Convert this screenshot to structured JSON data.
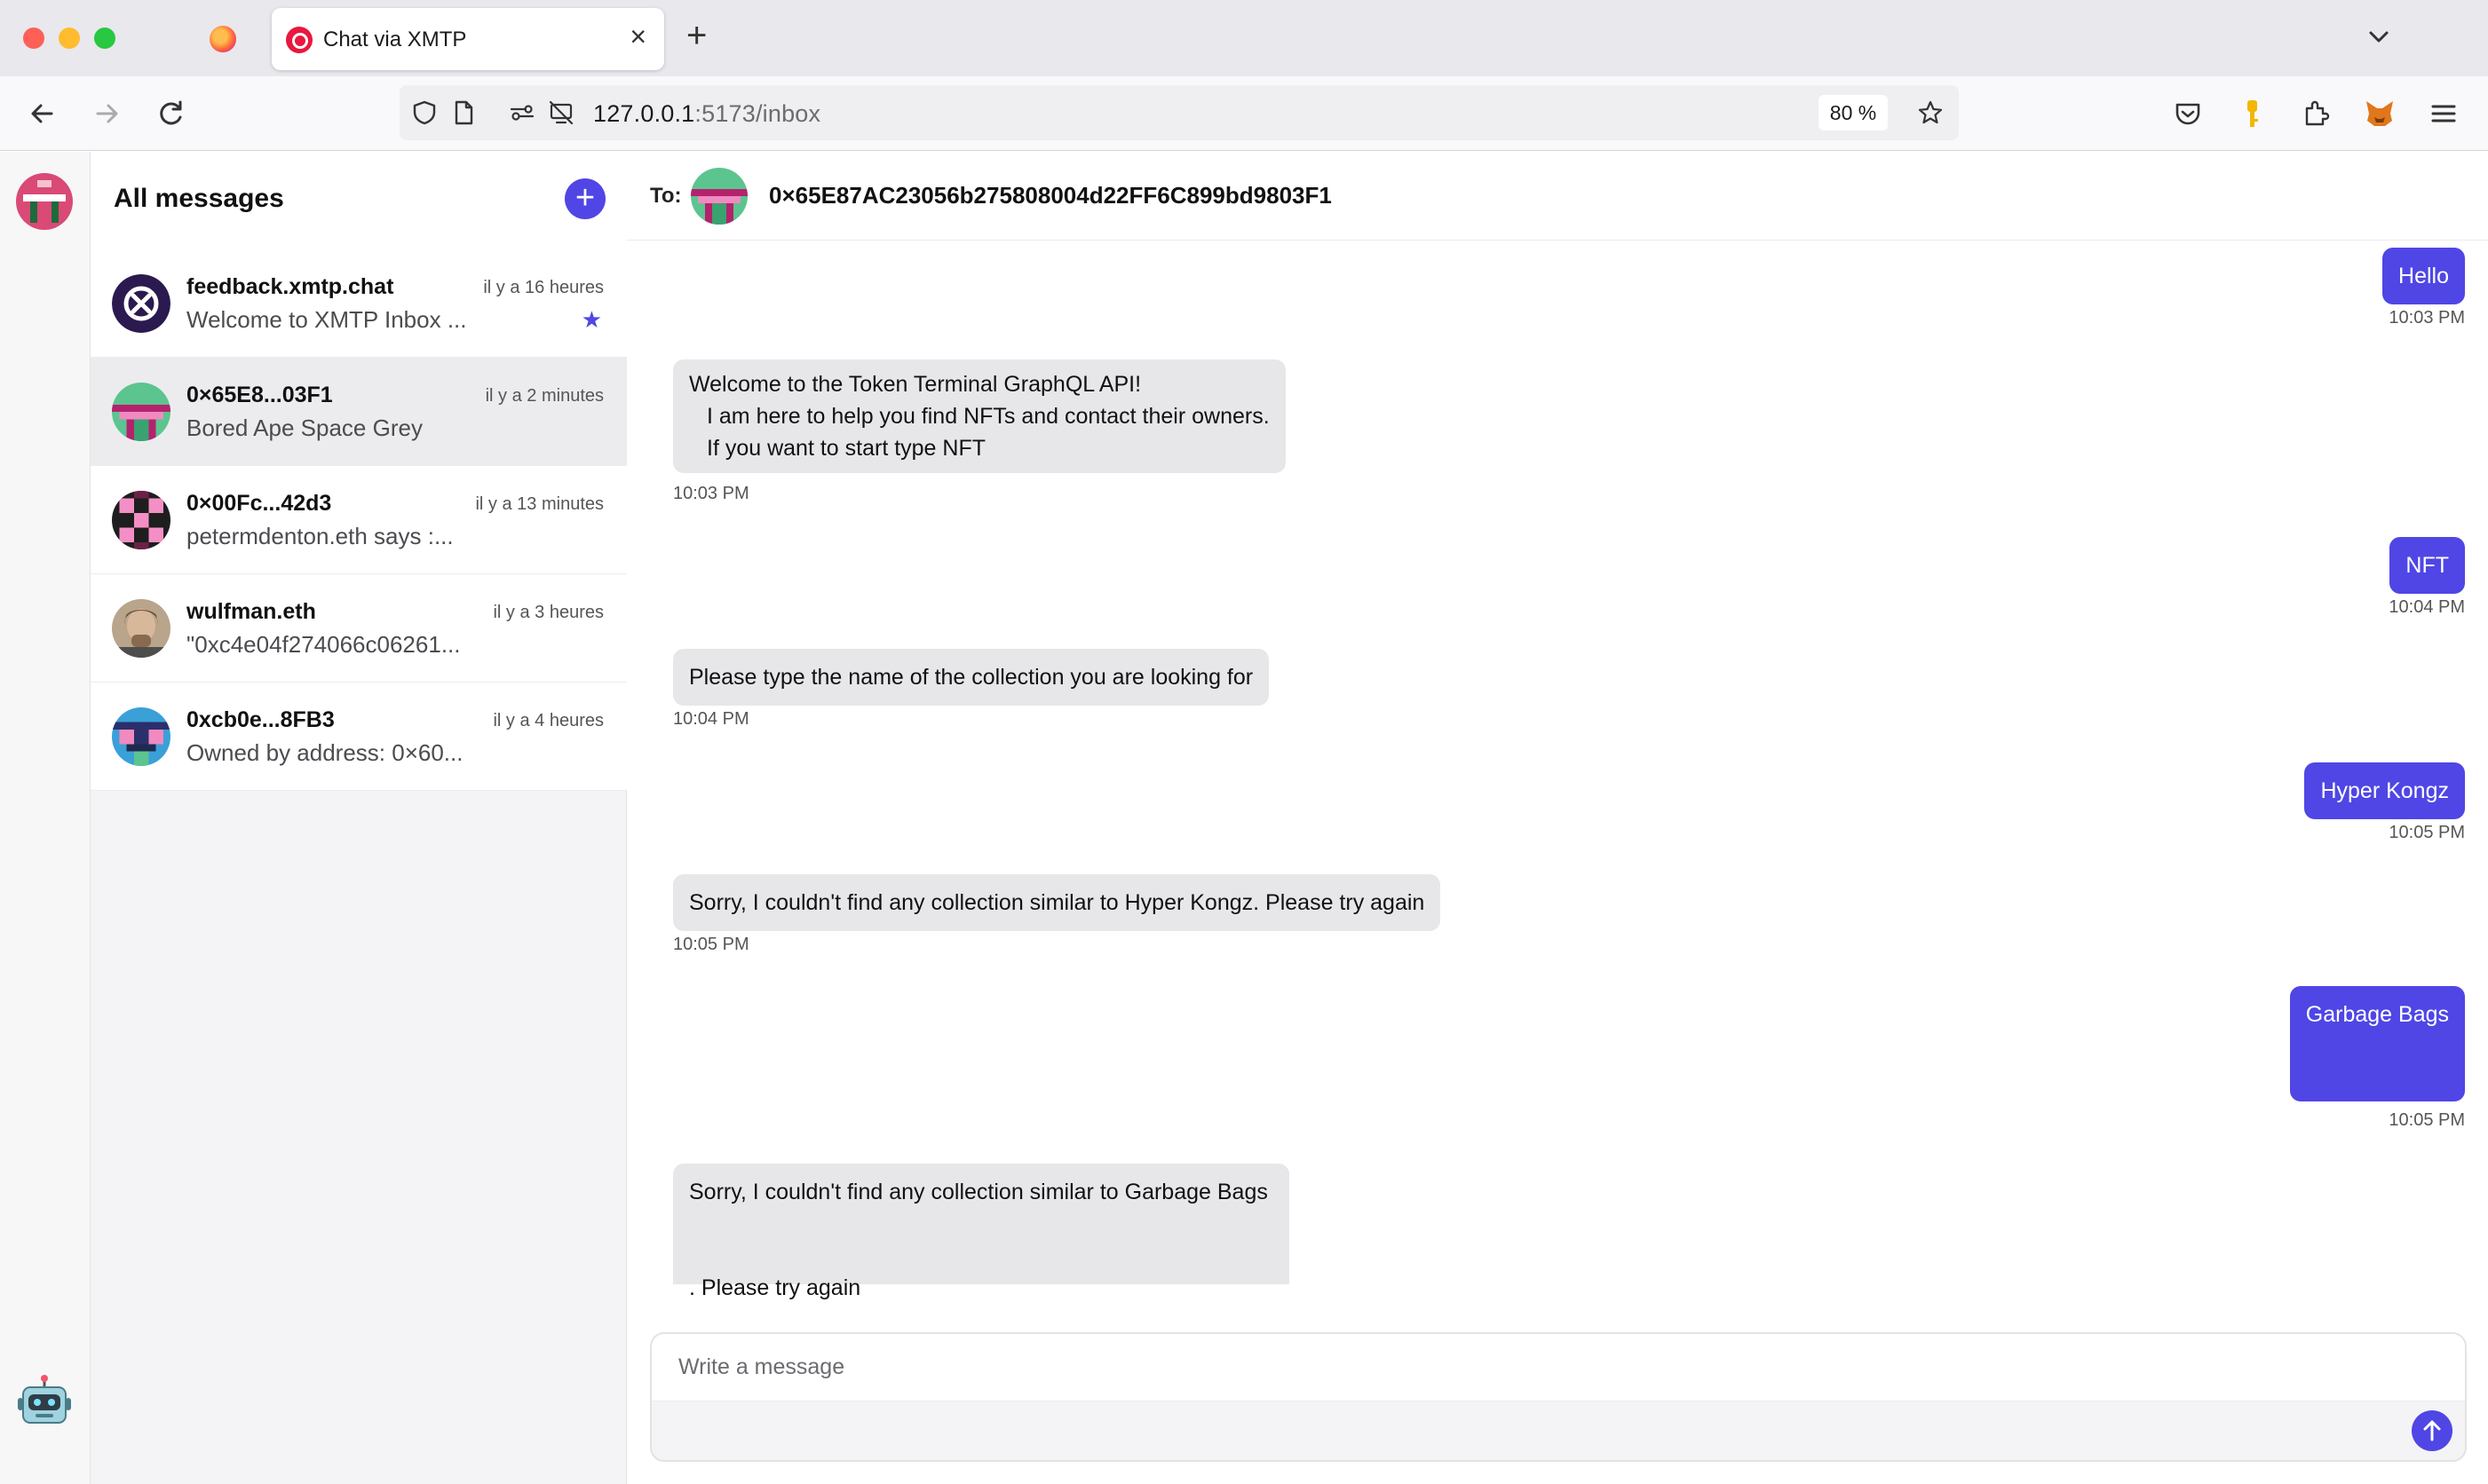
{
  "browser": {
    "tab_title": "Chat via XMTP",
    "url_host": "127.0.0.1",
    "url_path": ":5173/inbox",
    "zoom": "80 %"
  },
  "sidebar": {
    "title": "All messages",
    "conversations": [
      {
        "name": "feedback.xmtp.chat",
        "preview": "Welcome to XMTP Inbox ...",
        "time": "il y a 16 heures",
        "starred": true
      },
      {
        "name": "0×65E8...03F1",
        "preview": "Bored Ape Space Grey",
        "time": "il y a 2 minutes"
      },
      {
        "name": "0×00Fc...42d3",
        "preview": "petermdenton.eth says :...",
        "time": "il y a 13 minutes"
      },
      {
        "name": "wulfman.eth",
        "preview": "\"0xc4e04f274066c06261...",
        "time": "il y a 3 heures"
      },
      {
        "name": "0xcb0e...8FB3",
        "preview": "Owned by address: 0×60...",
        "time": "il y a 4 heures"
      }
    ]
  },
  "chat": {
    "to_label": "To:",
    "to_address": "0×65E87AC23056b275808004d22FF6C899bd9803F1",
    "messages": [
      {
        "dir": "out",
        "text": "Hello",
        "time": "10:03 PM"
      },
      {
        "dir": "in",
        "lines": [
          "Welcome to the Token Terminal GraphQL API!",
          "I am here to help you find NFTs and contact their owners.",
          "If you want to start type NFT"
        ],
        "time": "10:03 PM"
      },
      {
        "dir": "out",
        "text": "NFT",
        "time": "10:04 PM"
      },
      {
        "dir": "in",
        "text": "Please type the name of the collection you are looking for",
        "time": "10:04 PM"
      },
      {
        "dir": "out",
        "text": "Hyper Kongz",
        "time": "10:05 PM"
      },
      {
        "dir": "in",
        "text": "Sorry, I couldn't find any collection similar to Hyper Kongz. Please try again",
        "time": "10:05 PM"
      },
      {
        "dir": "out",
        "text": "Garbage Bags",
        "time": "10:05 PM"
      },
      {
        "dir": "in",
        "lines": [
          "Sorry, I couldn't find any collection similar to Garbage Bags",
          ". Please try again"
        ]
      }
    ],
    "composer_placeholder": "Write a message"
  },
  "colors": {
    "accent": "#4f46e5",
    "incoming_bubble": "#e7e7ea"
  }
}
